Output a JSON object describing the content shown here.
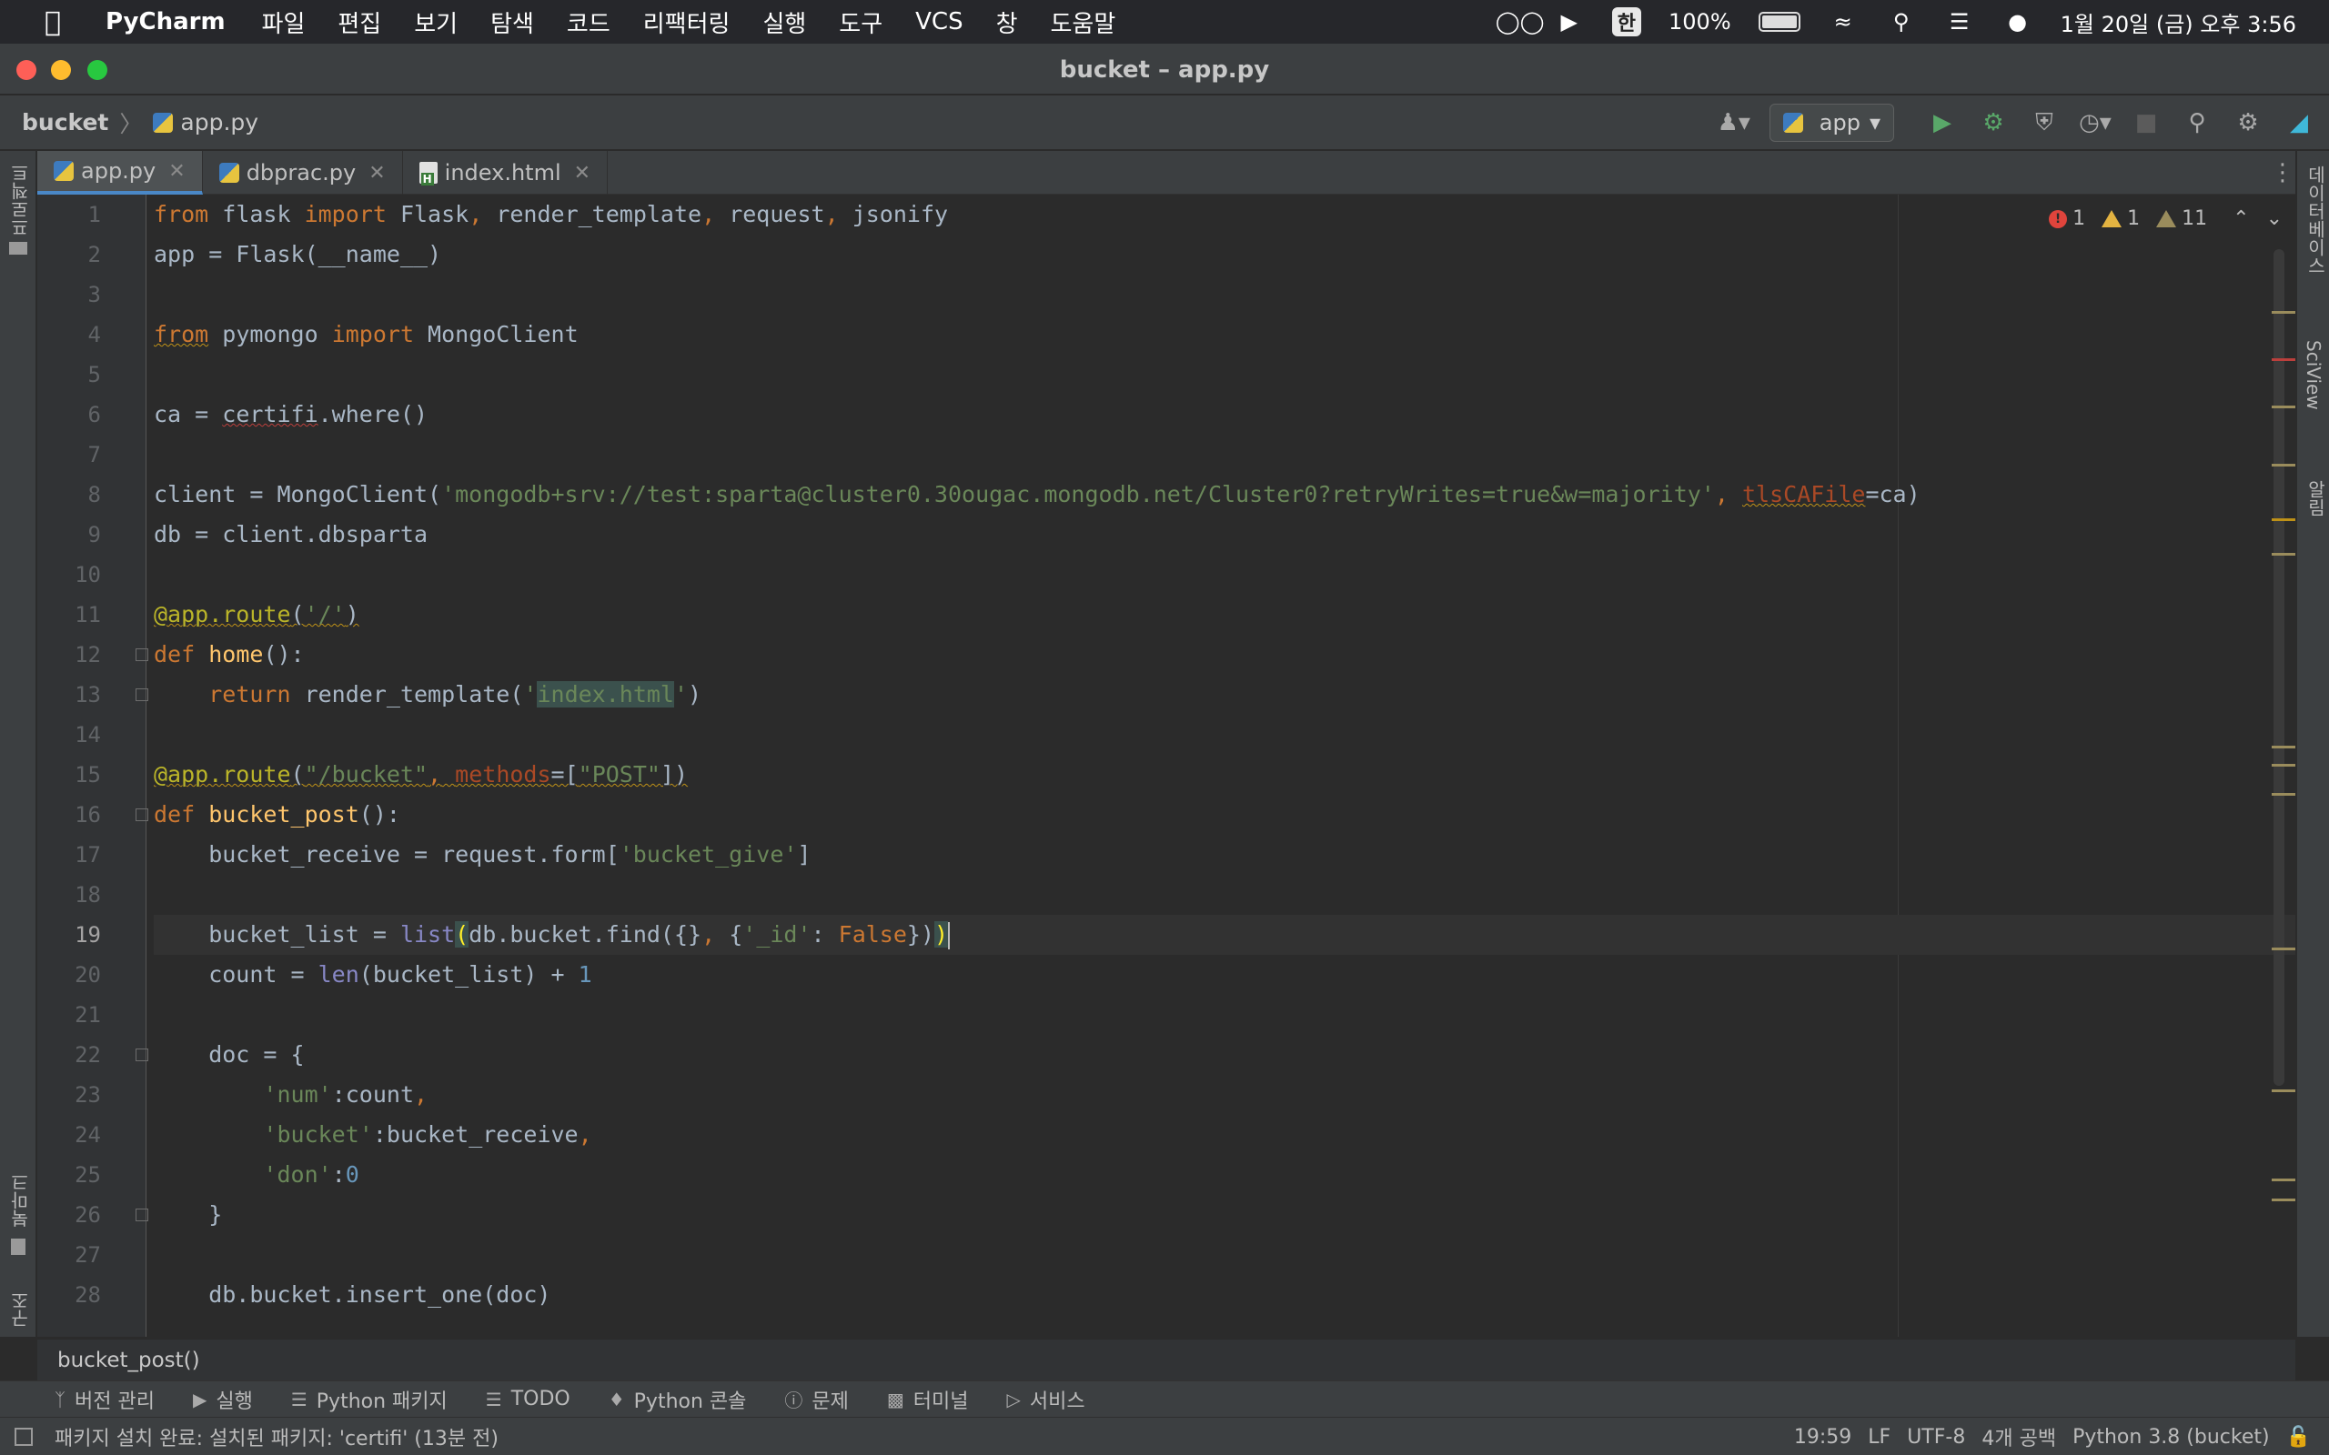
{
  "menubar": {
    "app_name": "PyCharm",
    "items": [
      "파일",
      "편집",
      "보기",
      "탐색",
      "코드",
      "리팩터링",
      "실행",
      "도구",
      "VCS",
      "창",
      "도움말"
    ],
    "input_method": "한",
    "battery": "100%",
    "datetime": "1월 20일 (금) 오후 3:56"
  },
  "window": {
    "title": "bucket – app.py"
  },
  "navbar": {
    "project": "bucket",
    "file": "app.py",
    "run_config": "app"
  },
  "left_strip": {
    "project_label": "프로젝트",
    "bookmarks_label": "북마크",
    "structure_label": "구조"
  },
  "right_strip": {
    "database_label": "데이터베이스",
    "sciview_label": "SciView",
    "notifications_label": "알림"
  },
  "tabs": [
    {
      "label": "app.py",
      "active": true,
      "icon": "python-file-icon"
    },
    {
      "label": "dbprac.py",
      "active": false,
      "icon": "python-file-icon"
    },
    {
      "label": "index.html",
      "active": false,
      "icon": "html-file-icon"
    }
  ],
  "inspections": {
    "errors": "1",
    "warnings": "1",
    "weak_warnings": "11"
  },
  "code": {
    "current_line": 19,
    "lines": [
      "from flask import Flask, render_template, request, jsonify",
      "app = Flask(__name__)",
      "",
      "from pymongo import MongoClient",
      "",
      "ca = certifi.where()",
      "",
      "client = MongoClient('mongodb+srv://test:sparta@cluster0.30ougac.mongodb.net/Cluster0?retryWrites=true&w=majority', tlsCAFile=ca)",
      "db = client.dbsparta",
      "",
      "@app.route('/')",
      "def home():",
      "    return render_template('index.html')",
      "",
      "@app.route(\"/bucket\", methods=[\"POST\"])",
      "def bucket_post():",
      "    bucket_receive = request.form['bucket_give']",
      "",
      "    bucket_list = list(db.bucket.find({}, {'_id': False}))",
      "    count = len(bucket_list) + 1",
      "",
      "    doc = {",
      "        'num':count,",
      "        'bucket':bucket_receive,",
      "        'don':0",
      "    }",
      "",
      "    db.bucket.insert_one(doc)"
    ]
  },
  "editor_breadcrumb": "bucket_post()",
  "toolwindows": [
    {
      "label": "버전 관리",
      "icon": "branch-icon"
    },
    {
      "label": "실행",
      "icon": "play-icon"
    },
    {
      "label": "Python 패키지",
      "icon": "layers-icon"
    },
    {
      "label": "TODO",
      "icon": "list-icon"
    },
    {
      "label": "Python 콘솔",
      "icon": "python-icon"
    },
    {
      "label": "문제",
      "icon": "problem-icon"
    },
    {
      "label": "터미널",
      "icon": "terminal-icon"
    },
    {
      "label": "서비스",
      "icon": "services-icon"
    }
  ],
  "status": {
    "message": "패키지 설치 완료: 설치된 패키지: 'certifi' (13분 전)",
    "position": "19:59",
    "line_sep": "LF",
    "encoding": "UTF-8",
    "indent": "4개 공백",
    "interpreter": "Python 3.8 (bucket)"
  },
  "colors": {
    "keyword": "#cc7832",
    "string": "#6a8759",
    "number": "#6897bb",
    "decorator": "#bbb529",
    "function": "#ffc66d",
    "builtin": "#8888c6",
    "editor_bg": "#2b2b2b",
    "accent": "#4a88c7"
  }
}
